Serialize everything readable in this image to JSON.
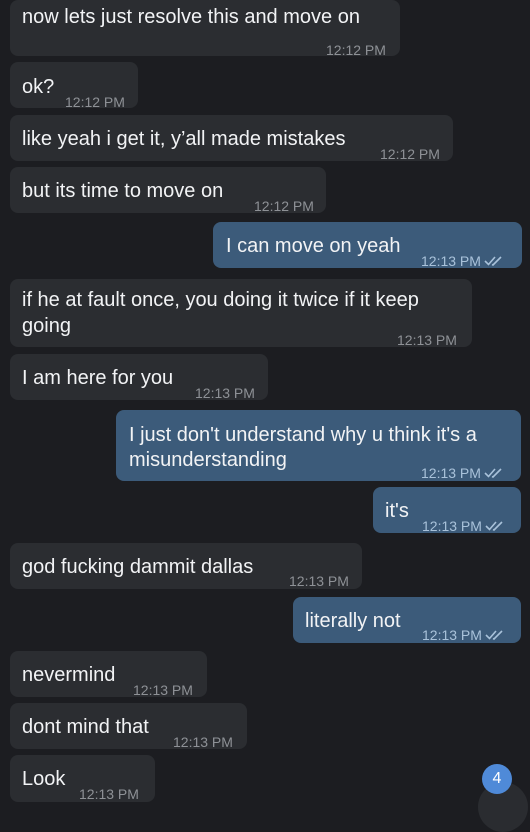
{
  "messages": [
    {
      "text": "now lets just resolve this and move on",
      "time": "12:12 PM"
    },
    {
      "text": "ok?",
      "time": "12:12 PM"
    },
    {
      "text": "like yeah i get it, y’all made mistakes",
      "time": "12:12 PM"
    },
    {
      "text": "but its time to move on",
      "time": "12:12 PM"
    },
    {
      "text": "I can move on yeah",
      "time": "12:13 PM"
    },
    {
      "line1": "if he at fault once, you doing it twice if it keep",
      "line2": "going",
      "time": "12:13 PM"
    },
    {
      "text": "I am here for you",
      "time": "12:13 PM"
    },
    {
      "line1": "I just don't understand why u think it's a",
      "line2": "misunderstanding",
      "time": "12:13 PM"
    },
    {
      "text": "it's",
      "time": "12:13 PM"
    },
    {
      "text": "god fucking dammit dallas",
      "time": "12:13 PM"
    },
    {
      "text": "literally not",
      "time": "12:13 PM"
    },
    {
      "text": "nevermind",
      "time": "12:13 PM"
    },
    {
      "text": "dont mind that",
      "time": "12:13 PM"
    },
    {
      "text": "Look",
      "time": "12:13 PM"
    }
  ],
  "unread_badge": "4",
  "colors": {
    "background": "#1c1d21",
    "incoming_bubble": "#2b2d31",
    "outgoing_bubble": "#3c5b7a",
    "badge": "#4f8ad8"
  },
  "icons": {
    "read_receipt": "double-check-icon",
    "scroll_down": "scroll-down-button"
  }
}
